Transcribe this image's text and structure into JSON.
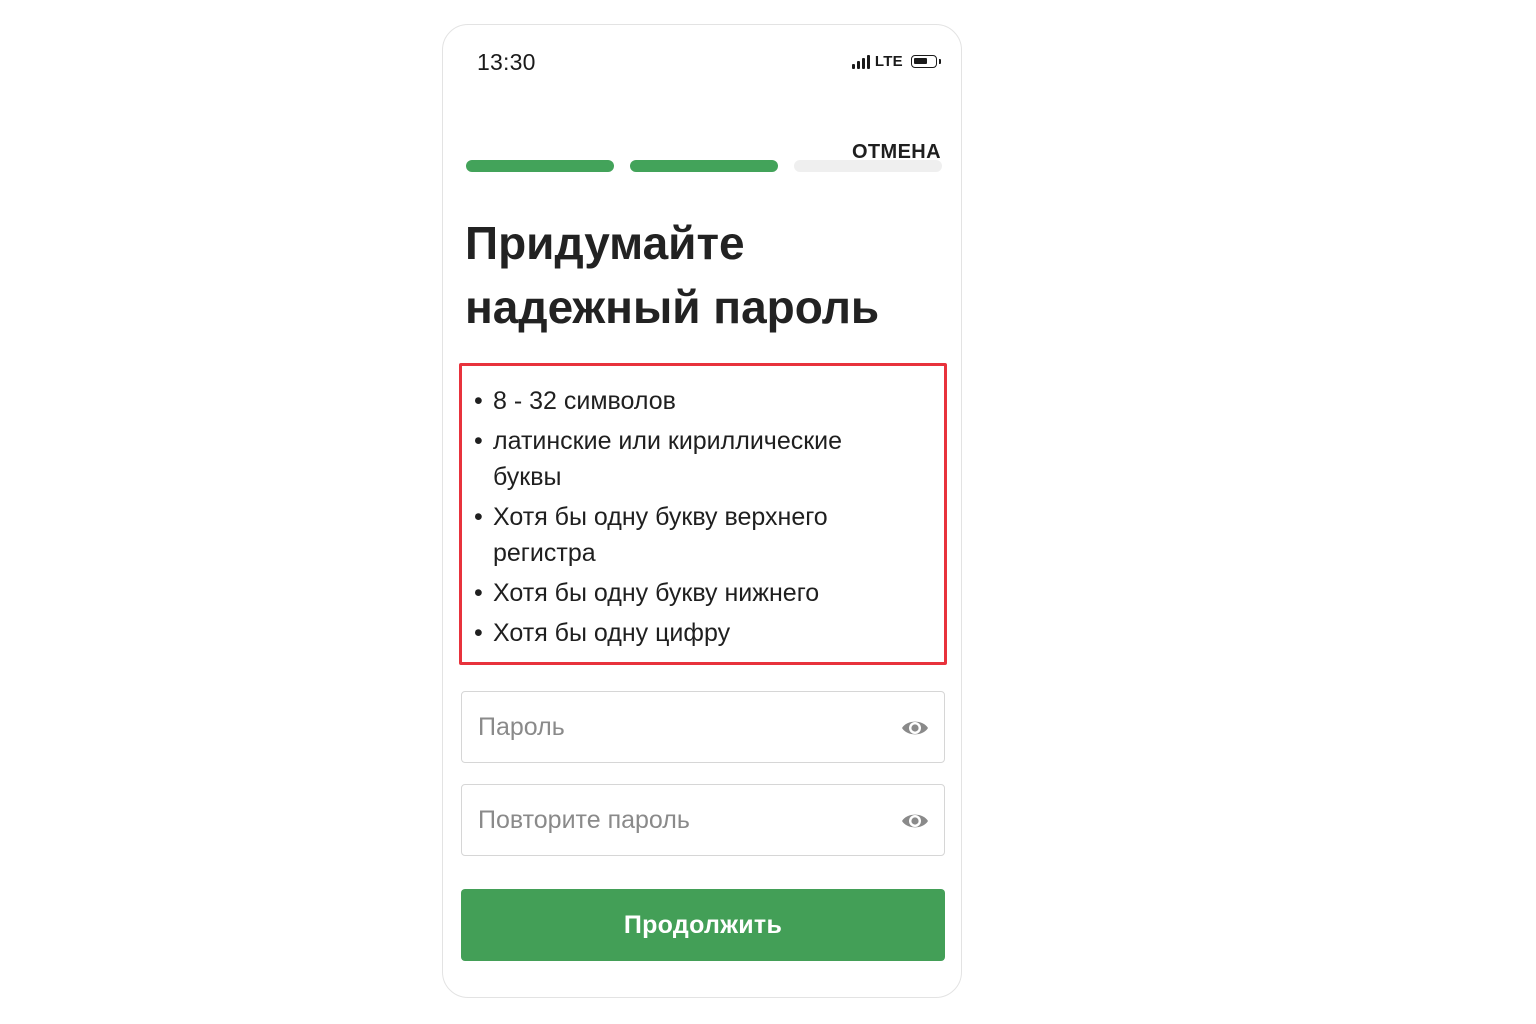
{
  "status_bar": {
    "time": "13:30",
    "network": "LTE",
    "signal_bars": 4,
    "battery_level": 0.7
  },
  "header": {
    "cancel_label": "ОТМЕНА"
  },
  "progress": {
    "total_steps": 3,
    "completed_steps": 2,
    "active_color": "#43a35a",
    "inactive_color": "#efefef"
  },
  "title": {
    "line1": "Придумайте",
    "line2": "надежный пароль"
  },
  "requirements": {
    "highlight_color": "#e8323c",
    "items": [
      "8 - 32 символов",
      "латинские или кириллические буквы",
      "Хотя бы одну букву верхнего регистра",
      "Хотя бы одну букву нижнего",
      "Хотя бы одну цифру"
    ]
  },
  "form": {
    "password": {
      "value": "",
      "placeholder": "Пароль",
      "toggle_icon": "eye-icon"
    },
    "repeat_password": {
      "value": "",
      "placeholder": "Повторите пароль",
      "toggle_icon": "eye-icon"
    },
    "submit_label": "Продолжить",
    "submit_color": "#439f57"
  }
}
